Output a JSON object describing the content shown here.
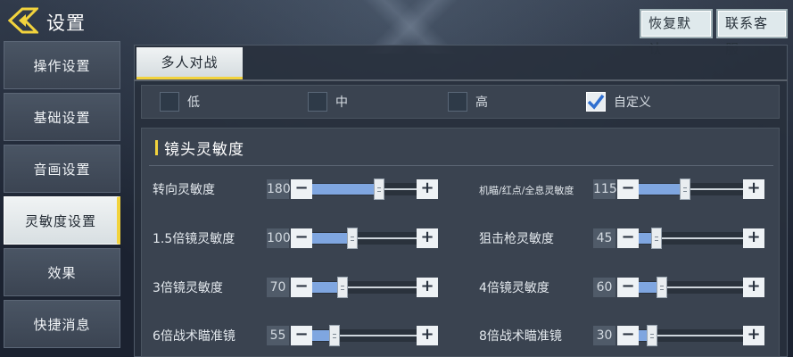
{
  "header": {
    "title": "设置",
    "restore_label": "恢复默认",
    "contact_label": "联系客服"
  },
  "sidebar": {
    "items": [
      {
        "label": "操作设置",
        "active": false
      },
      {
        "label": "基础设置",
        "active": false
      },
      {
        "label": "音画设置",
        "active": false
      },
      {
        "label": "灵敏度设置",
        "active": true
      },
      {
        "label": "效果",
        "active": false
      },
      {
        "label": "快捷消息",
        "active": false
      }
    ]
  },
  "tabs": [
    {
      "label": "多人对战",
      "active": true
    }
  ],
  "quality": {
    "options": [
      {
        "label": "低",
        "checked": false
      },
      {
        "label": "中",
        "checked": false
      },
      {
        "label": "高",
        "checked": false
      },
      {
        "label": "自定义",
        "checked": true
      }
    ]
  },
  "section": {
    "title": "镜头灵敏度"
  },
  "sliders": [
    {
      "label": "转向灵敏度",
      "value": "180",
      "fraction": 0.59
    },
    {
      "label": "机瞄/红点/全息灵敏度",
      "value": "115",
      "fraction": 0.39
    },
    {
      "label": "1.5倍镜灵敏度",
      "value": "100",
      "fraction": 0.33
    },
    {
      "label": "狙击枪灵敏度",
      "value": "45",
      "fraction": 0.12
    },
    {
      "label": "3倍镜灵敏度",
      "value": "70",
      "fraction": 0.24
    },
    {
      "label": "4倍镜灵敏度",
      "value": "60",
      "fraction": 0.17
    },
    {
      "label": "6倍战术瞄准镜",
      "value": "55",
      "fraction": 0.16
    },
    {
      "label": "8倍战术瞄准镜",
      "value": "30",
      "fraction": 0.08
    }
  ],
  "controls": {
    "minus": "−",
    "plus": "+"
  },
  "colors": {
    "accent": "#f2d33d",
    "slider_fill": "#7fa6e0"
  }
}
